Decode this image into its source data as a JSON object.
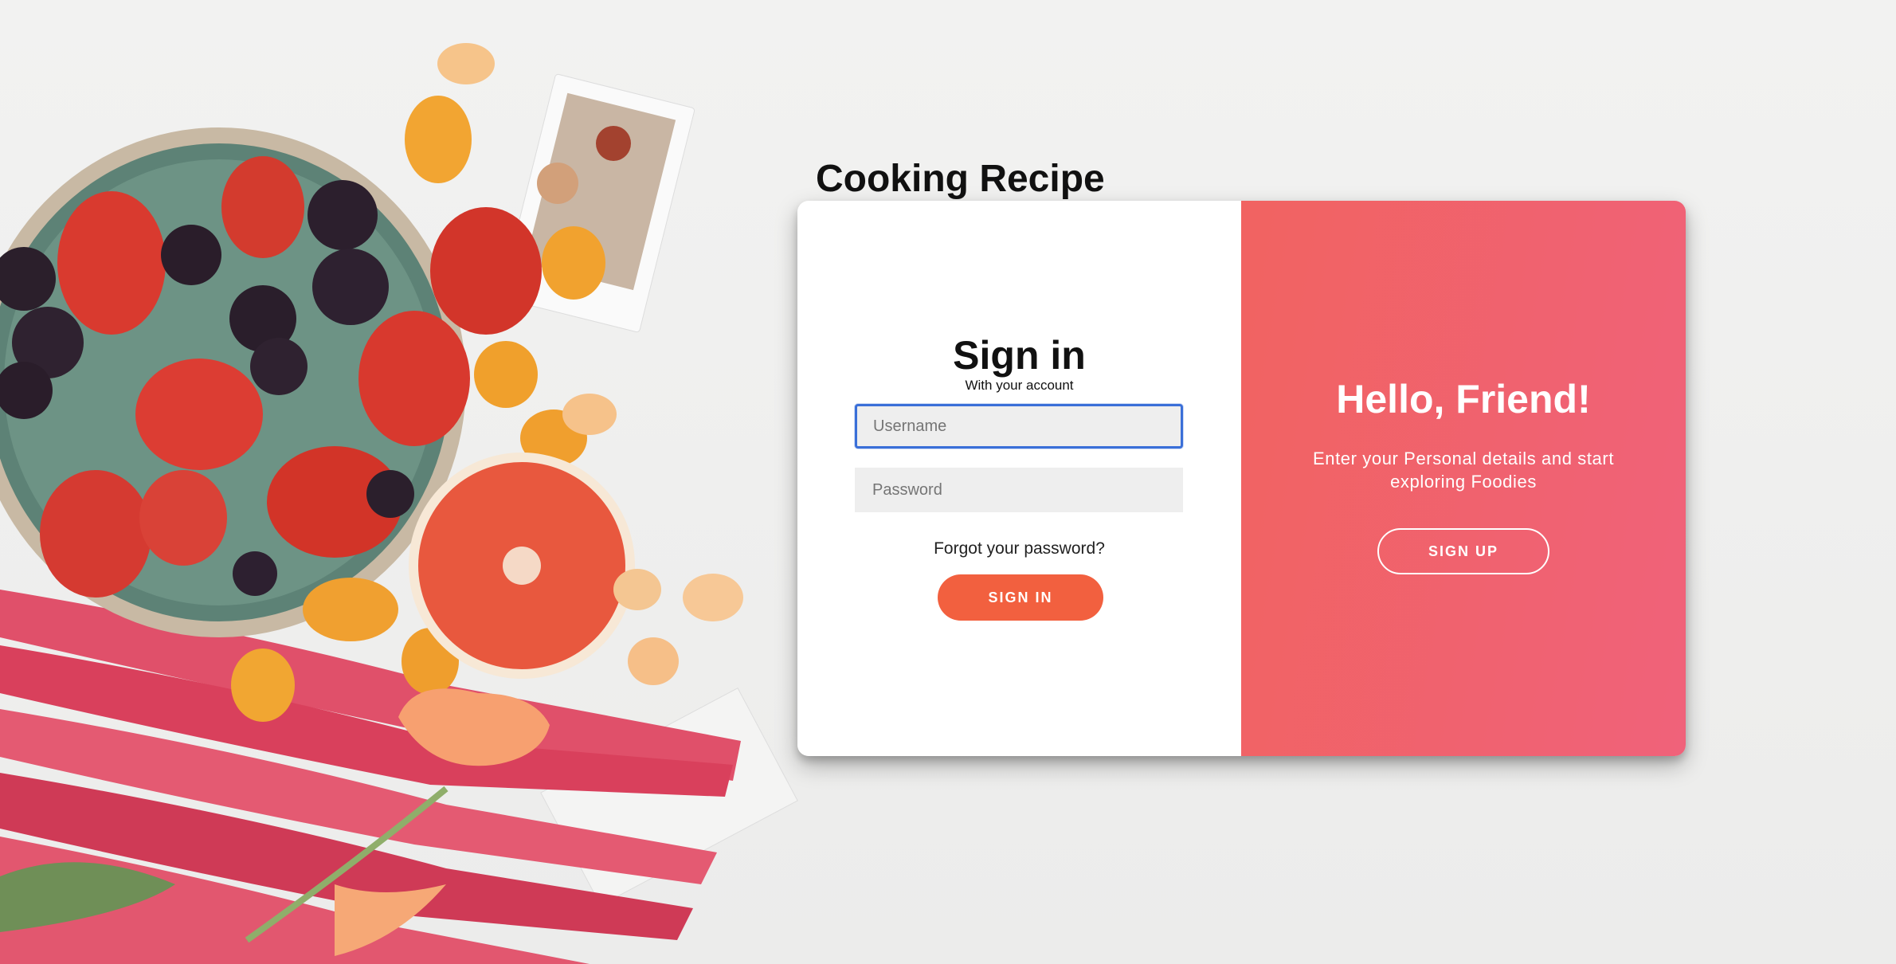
{
  "app": {
    "title": "Cooking Recipe"
  },
  "signin": {
    "heading": "Sign in",
    "subtitle": "With your account",
    "username_placeholder": "Username",
    "username_value": "",
    "password_placeholder": "Password",
    "password_value": "",
    "forgot_link": "Forgot your password?",
    "button_label": "SIGN IN"
  },
  "welcome": {
    "heading": "Hello, Friend!",
    "text": "Enter your Personal details and start exploring Foodies",
    "button_label": "SIGN UP"
  },
  "colors": {
    "accent_orange": "#f2603f",
    "panel_gradient_start": "#f16361",
    "panel_gradient_end": "#f0627a",
    "focus_border": "#3a6fd8"
  }
}
